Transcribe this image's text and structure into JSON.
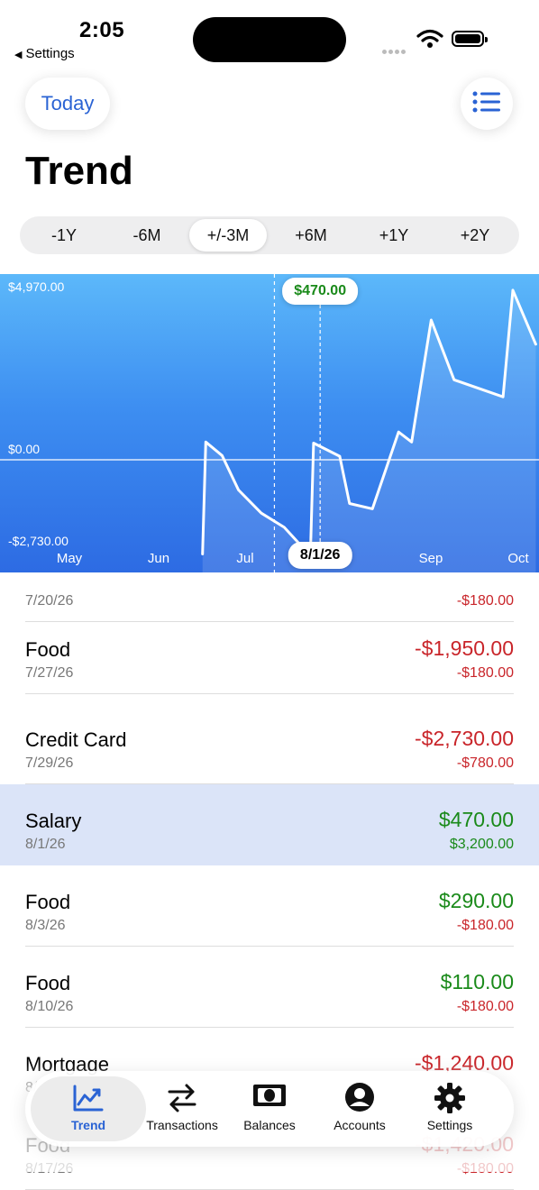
{
  "status_bar": {
    "time": "2:05",
    "back_label": "Settings"
  },
  "header": {
    "today_label": "Today",
    "title": "Trend",
    "list_icon": "list-icon"
  },
  "ranges": [
    "-1Y",
    "-6M",
    "+/-3M",
    "+6M",
    "+1Y",
    "+2Y"
  ],
  "selected_range": "+/-3M",
  "chart_data": {
    "type": "line",
    "y_tick_labels": [
      "$4,970.00",
      "$0.00",
      "-$2,730.00"
    ],
    "x_tick_labels": [
      "May",
      "Jun",
      "Jul",
      "Sep",
      "Oct"
    ],
    "ylim": [
      -2730,
      4970
    ],
    "selected_point": {
      "date": "8/1/26",
      "value_label": "$470.00"
    },
    "colors": {
      "gradient_top": "#5cb8fa",
      "gradient_bottom": "#2d6be3",
      "line": "#ffffff"
    },
    "series": [
      {
        "x": [
          "2026-06-29",
          "2026-06-30",
          "2026-07-05",
          "2026-07-10",
          "2026-07-17",
          "2026-07-24",
          "2026-07-30",
          "2026-08-01",
          "2026-08-02",
          "2026-08-10",
          "2026-08-13",
          "2026-08-20",
          "2026-08-28",
          "2026-09-01",
          "2026-09-07",
          "2026-09-14",
          "2026-09-29",
          "2026-10-02",
          "2026-10-09"
        ],
        "y": [
          -2650,
          500,
          120,
          -850,
          -1500,
          -1900,
          -2500,
          -2730,
          470,
          100,
          -1230,
          -1380,
          780,
          500,
          3930,
          2250,
          1770,
          4770,
          3250
        ]
      }
    ]
  },
  "transactions": [
    {
      "name": "",
      "date": "7/20/26",
      "balance": "",
      "amount": "-$180.00",
      "balance_sign": "neg",
      "amount_sign": "neg",
      "selected": false
    },
    {
      "name": "Food",
      "date": "7/27/26",
      "balance": "-$1,950.00",
      "amount": "-$180.00",
      "balance_sign": "neg",
      "amount_sign": "neg",
      "selected": false
    },
    {
      "name": "Credit Card",
      "date": "7/29/26",
      "balance": "-$2,730.00",
      "amount": "-$780.00",
      "balance_sign": "neg",
      "amount_sign": "neg",
      "selected": false
    },
    {
      "name": "Salary",
      "date": "8/1/26",
      "balance": "$470.00",
      "amount": "$3,200.00",
      "balance_sign": "pos",
      "amount_sign": "pos",
      "selected": true
    },
    {
      "name": "Food",
      "date": "8/3/26",
      "balance": "$290.00",
      "amount": "-$180.00",
      "balance_sign": "pos",
      "amount_sign": "neg",
      "selected": false
    },
    {
      "name": "Food",
      "date": "8/10/26",
      "balance": "$110.00",
      "amount": "-$180.00",
      "balance_sign": "pos",
      "amount_sign": "neg",
      "selected": false
    },
    {
      "name": "Mortgage",
      "date": "8/",
      "balance": "-$1,240.00",
      "amount": "",
      "balance_sign": "neg",
      "amount_sign": "neg",
      "selected": false
    },
    {
      "name": "Food",
      "date": "8/17/26",
      "balance": "-$1,420.00",
      "amount": "-$180.00",
      "balance_sign": "neg",
      "amount_sign": "neg",
      "selected": false
    }
  ],
  "tabbar": [
    {
      "label": "Trend",
      "icon": "trend-chart-icon",
      "active": true
    },
    {
      "label": "Transactions",
      "icon": "swap-arrows-icon",
      "active": false
    },
    {
      "label": "Balances",
      "icon": "banknote-icon",
      "active": false
    },
    {
      "label": "Accounts",
      "icon": "person-circle-icon",
      "active": false
    },
    {
      "label": "Settings",
      "icon": "gear-icon",
      "active": false
    }
  ]
}
